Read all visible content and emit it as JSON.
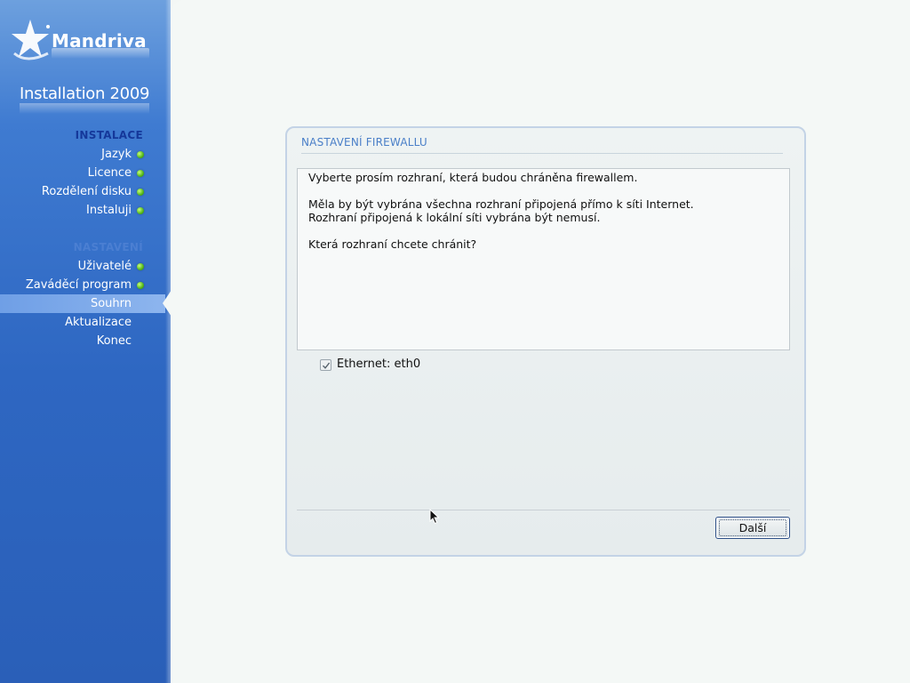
{
  "sidebar": {
    "brand": "Mandriva",
    "install_title": "Installation 2009",
    "sections": [
      {
        "heading": "INSTALACE",
        "items": [
          {
            "label": "Jazyk",
            "done": true
          },
          {
            "label": "Licence",
            "done": true
          },
          {
            "label": "Rozdělení disku",
            "done": true
          },
          {
            "label": "Instaluji",
            "done": true
          }
        ]
      },
      {
        "heading": "NASTAVENÍ",
        "items": [
          {
            "label": "Uživatelé",
            "done": true
          },
          {
            "label": "Zaváděcí program",
            "done": true
          },
          {
            "label": "Souhrn",
            "done": false,
            "active": true
          },
          {
            "label": "Aktualizace",
            "done": false
          },
          {
            "label": "Konec",
            "done": false
          }
        ]
      }
    ],
    "colors": {
      "active_heading": "#15389a",
      "dim_heading": "#4b7fd2",
      "done_dot": "#52b51a"
    }
  },
  "dialog": {
    "title": "NASTAVENÍ FIREWALLU",
    "lines": [
      "Vyberte prosím rozhraní, která budou chráněna firewallem.",
      "",
      "Měla by být vybrána všechna rozhraní připojená přímo k síti Internet.",
      "Rozhraní připojená k lokální síti vybrána být nemusí.",
      "",
      "Která rozhraní chcete chránit?"
    ],
    "checkbox": {
      "label": "Ethernet: eth0",
      "checked": true
    },
    "next_button": "Další"
  }
}
